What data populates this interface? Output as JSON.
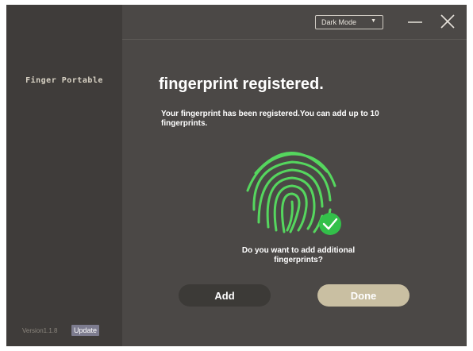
{
  "app": {
    "name": "Finger Portable",
    "version": "Version1.1.8",
    "update_label": "Update"
  },
  "header": {
    "mode_select": {
      "selected": "Dark Mode",
      "arrow": "▼"
    },
    "minimize_icon": "minimize-icon",
    "close_icon": "close-icon"
  },
  "main": {
    "title": "fingerprint registered.",
    "description": "Your fingerprint has been registered.You can add up to 10 fingerprints.",
    "question": "Do you want to add additional fingerprints?",
    "add_label": "Add",
    "done_label": "Done",
    "fingerprint_icon": "fingerprint-icon",
    "check_icon": "check-badge-icon"
  },
  "colors": {
    "background": "#4b4846",
    "sidebar": "#3f3c3a",
    "fingerprint": "#55d65e",
    "check_badge": "#33c04a",
    "add_button": "#3c3a37",
    "done_button": "#c9bfa2",
    "update_button": "#7d7c8f"
  }
}
